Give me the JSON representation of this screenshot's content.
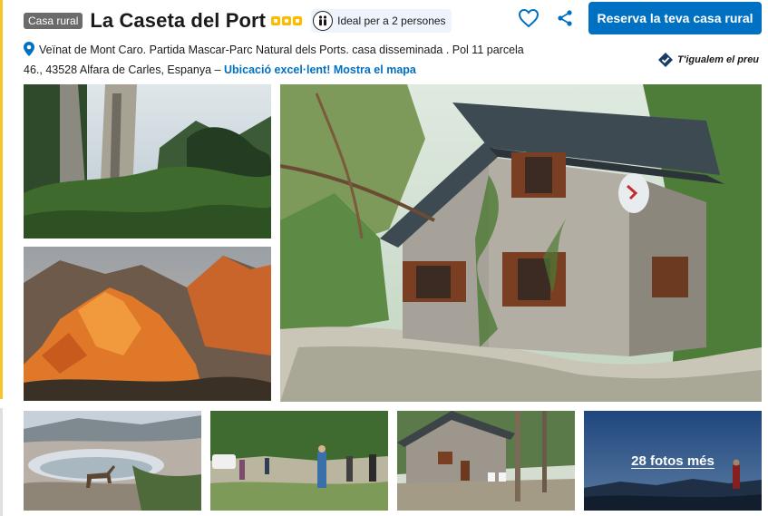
{
  "header": {
    "type_badge": "Casa rural",
    "title": "La Caseta del Port",
    "rating_squares": 3,
    "ideal_label": "Ideal per a 2 persones",
    "reserve_label": "Reserva la teva casa rural"
  },
  "address": {
    "text": "Veïnat de Mont Caro. Partida Mascar-Parc Natural dels Ports. casa disseminada . Pol 11 parcela 46., 43528 Alfara de Carles, Espanya – ",
    "link": "Ubicació excel·lent! Mostra el mapa"
  },
  "price_match": "T'igualem el preu",
  "gallery": {
    "more_label": "28 fotos més",
    "photos": [
      {
        "icon": "forest-pines-photo"
      },
      {
        "icon": "orange-cliffs-sunset-photo"
      },
      {
        "icon": "stone-house-photo"
      },
      {
        "icon": "mountain-ibex-pond-photo"
      },
      {
        "icon": "hikers-group-photo"
      },
      {
        "icon": "house-terrace-photo"
      },
      {
        "icon": "mountain-view-photo"
      }
    ]
  },
  "colors": {
    "brand_blue": "#0071c2",
    "rating_yellow": "#febb02",
    "badge_grey": "#6b6b6b"
  }
}
